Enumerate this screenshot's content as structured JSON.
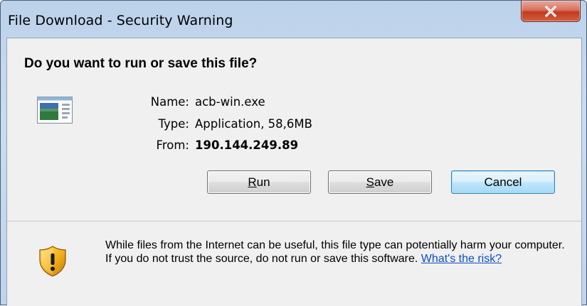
{
  "window": {
    "title": "File Download - Security Warning",
    "close_label": "X"
  },
  "prompt": {
    "question": "Do you want to run or save this file?"
  },
  "file": {
    "name_label": "Name:",
    "name_value": "acb-win.exe",
    "type_label": "Type:",
    "type_value": "Application, 58,6MB",
    "from_label": "From:",
    "from_value": "190.144.249.89",
    "icon": "application-window-icon"
  },
  "buttons": {
    "run_prefix": "",
    "run_mnemonic": "R",
    "run_rest": "un",
    "save_mnemonic": "S",
    "save_rest": "ave",
    "cancel_label": "Cancel"
  },
  "warning": {
    "icon": "shield-warning-icon",
    "text": "While files from the Internet can be useful, this file type can potentially harm your computer. If you do not trust the source, do not run or save this software. ",
    "link_text": "What's the risk?"
  },
  "colors": {
    "link": "#0b4fc6",
    "close_button": "#c23a1e",
    "title_bar": "#bcd2ea",
    "default_button_border": "#3c7fb1"
  }
}
